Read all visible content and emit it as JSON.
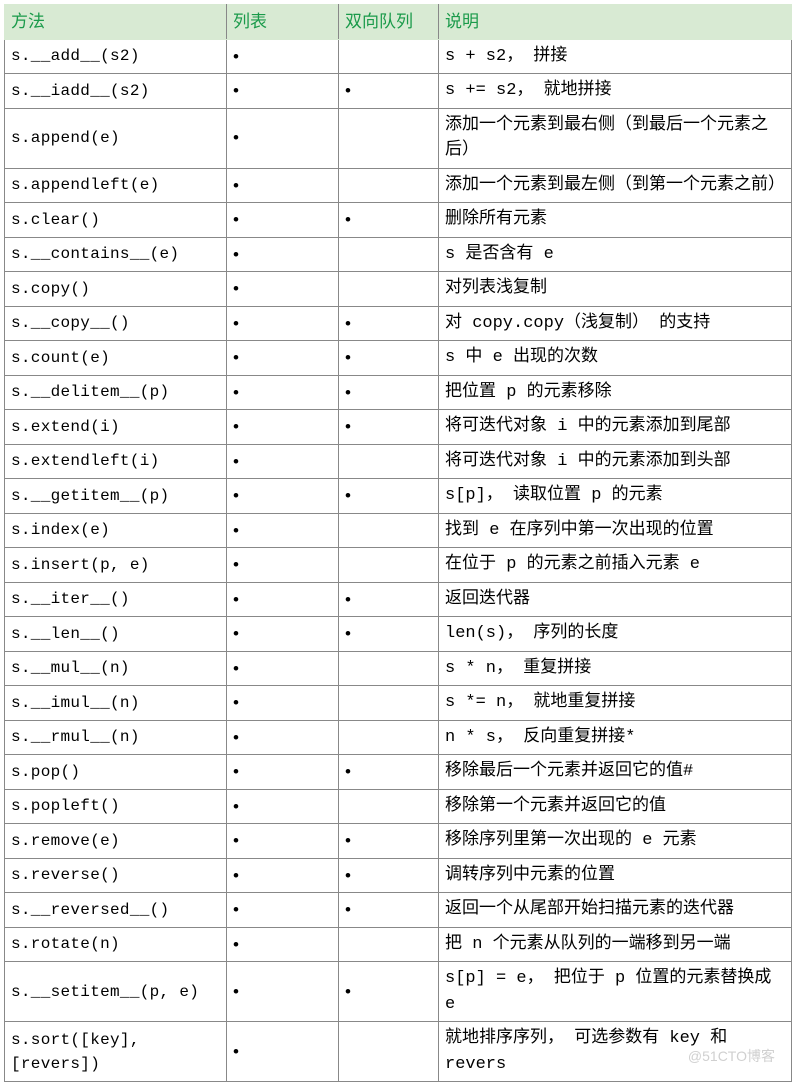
{
  "headers": [
    "方法",
    "列表",
    "双向队列",
    "说明"
  ],
  "dot": "•",
  "rows": [
    {
      "method": "s.__add__(s2)",
      "list": true,
      "deque": false,
      "desc": "s + s2， 拼接"
    },
    {
      "method": "s.__iadd__(s2)",
      "list": true,
      "deque": true,
      "desc": "s += s2， 就地拼接"
    },
    {
      "method": "s.append(e)",
      "list": true,
      "deque": false,
      "desc": "添加一个元素到最右侧（到最后一个元素之后）"
    },
    {
      "method": "s.appendleft(e)",
      "list": true,
      "deque": false,
      "desc": "添加一个元素到最左侧（到第一个元素之前）"
    },
    {
      "method": "s.clear()",
      "list": true,
      "deque": true,
      "desc": "删除所有元素"
    },
    {
      "method": "s.__contains__(e)",
      "list": true,
      "deque": false,
      "desc": "s 是否含有 e"
    },
    {
      "method": "s.copy()",
      "list": true,
      "deque": false,
      "desc": "对列表浅复制"
    },
    {
      "method": "s.__copy__()",
      "list": true,
      "deque": true,
      "desc": "对 copy.copy（浅复制） 的支持"
    },
    {
      "method": "s.count(e)",
      "list": true,
      "deque": true,
      "desc": "s 中 e 出现的次数"
    },
    {
      "method": "s.__delitem__(p)",
      "list": true,
      "deque": true,
      "desc": "把位置 p 的元素移除"
    },
    {
      "method": "s.extend(i)",
      "list": true,
      "deque": true,
      "desc": "将可迭代对象 i 中的元素添加到尾部"
    },
    {
      "method": "s.extendleft(i)",
      "list": true,
      "deque": false,
      "desc": "将可迭代对象 i 中的元素添加到头部"
    },
    {
      "method": "s.__getitem__(p)",
      "list": true,
      "deque": true,
      "desc": "s[p]， 读取位置 p 的元素"
    },
    {
      "method": "s.index(e)",
      "list": true,
      "deque": false,
      "desc": "找到 e 在序列中第一次出现的位置"
    },
    {
      "method": "s.insert(p, e)",
      "list": true,
      "deque": false,
      "desc": "在位于 p 的元素之前插入元素 e"
    },
    {
      "method": "s.__iter__()",
      "list": true,
      "deque": true,
      "desc": "返回迭代器"
    },
    {
      "method": "s.__len__()",
      "list": true,
      "deque": true,
      "desc": "len(s)， 序列的长度"
    },
    {
      "method": "s.__mul__(n)",
      "list": true,
      "deque": false,
      "desc": "s * n， 重复拼接"
    },
    {
      "method": "s.__imul__(n)",
      "list": true,
      "deque": false,
      "desc": "s *= n， 就地重复拼接"
    },
    {
      "method": "s.__rmul__(n)",
      "list": true,
      "deque": false,
      "desc": "n * s， 反向重复拼接*"
    },
    {
      "method": "s.pop()",
      "list": true,
      "deque": true,
      "desc": "移除最后一个元素并返回它的值#"
    },
    {
      "method": "s.popleft()",
      "list": true,
      "deque": false,
      "desc": "移除第一个元素并返回它的值"
    },
    {
      "method": "s.remove(e)",
      "list": true,
      "deque": true,
      "desc": "移除序列里第一次出现的 e 元素"
    },
    {
      "method": "s.reverse()",
      "list": true,
      "deque": true,
      "desc": "调转序列中元素的位置"
    },
    {
      "method": "s.__reversed__()",
      "list": true,
      "deque": true,
      "desc": "返回一个从尾部开始扫描元素的迭代器"
    },
    {
      "method": "s.rotate(n)",
      "list": true,
      "deque": false,
      "desc": "把 n 个元素从队列的一端移到另一端"
    },
    {
      "method": "s.__setitem__(p, e)",
      "list": true,
      "deque": true,
      "desc": "s[p] = e， 把位于 p 位置的元素替换成 e"
    },
    {
      "method": "s.sort([key], [revers])",
      "list": true,
      "deque": false,
      "desc": "就地排序序列， 可选参数有 key 和 revers"
    }
  ],
  "watermark": "@51CTO博客"
}
